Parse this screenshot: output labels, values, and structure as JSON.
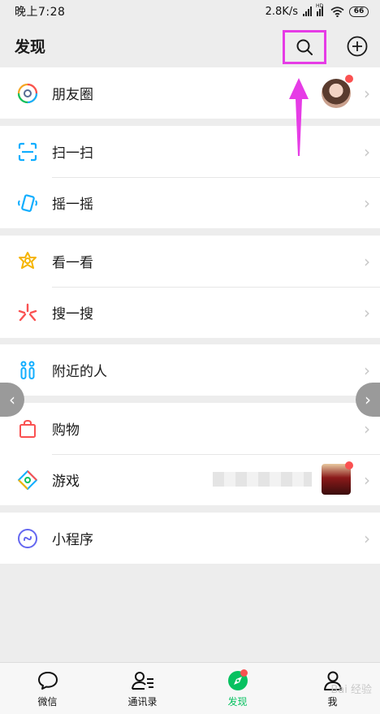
{
  "status": {
    "time": "晚上7:28",
    "speed": "2.8K/s",
    "network": "HD",
    "battery": "66"
  },
  "header": {
    "title": "发现"
  },
  "groups": [
    {
      "items": [
        {
          "label": "朋友圈",
          "icon": "moments-icon"
        }
      ]
    },
    {
      "items": [
        {
          "label": "扫一扫",
          "icon": "scan-icon"
        },
        {
          "label": "摇一摇",
          "icon": "shake-icon"
        }
      ]
    },
    {
      "items": [
        {
          "label": "看一看",
          "icon": "top-stories-icon"
        },
        {
          "label": "搜一搜",
          "icon": "search-search-icon"
        }
      ]
    },
    {
      "items": [
        {
          "label": "附近的人",
          "icon": "people-nearby-icon"
        }
      ]
    },
    {
      "items": [
        {
          "label": "购物",
          "icon": "shopping-icon"
        },
        {
          "label": "游戏",
          "icon": "games-icon"
        }
      ]
    },
    {
      "items": [
        {
          "label": "小程序",
          "icon": "mini-programs-icon"
        }
      ]
    }
  ],
  "tabs": [
    {
      "label": "微信",
      "icon": "chat-bubble-icon"
    },
    {
      "label": "通讯录",
      "icon": "contacts-icon"
    },
    {
      "label": "发现",
      "icon": "compass-icon",
      "active": true
    },
    {
      "label": "我",
      "icon": "person-icon"
    }
  ],
  "watermark": "Bai 经验",
  "colors": {
    "accent": "#07c160",
    "highlight": "#e63ce6",
    "badge": "#fa5151",
    "background": "#ededed"
  }
}
